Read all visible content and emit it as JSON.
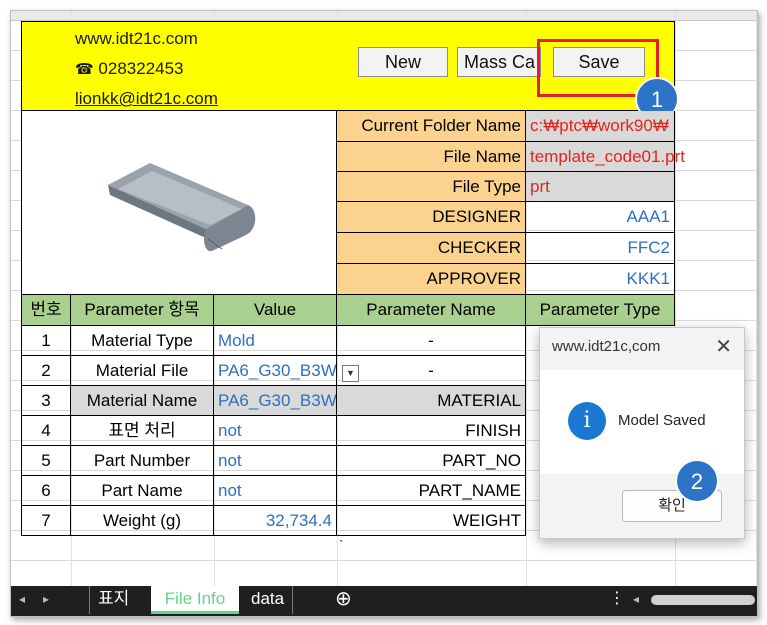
{
  "header": {
    "website": "www.idt21c.com",
    "phone_icon": "phone-icon",
    "phone": "028322453",
    "email": "lionkk@idt21c.com"
  },
  "buttons": {
    "new": "New",
    "mass_calc": "Mass Ca",
    "save": "Save"
  },
  "callouts": {
    "one": "1",
    "two": "2"
  },
  "file_info": [
    {
      "label": "Current Folder Name",
      "value": "c:₩ptc₩work90₩"
    },
    {
      "label": "File Name",
      "value": "template_code01.prt"
    },
    {
      "label": "File Type",
      "value": "prt"
    },
    {
      "label": "DESIGNER",
      "value": "AAA1"
    },
    {
      "label": "CHECKER",
      "value": "FFC2"
    },
    {
      "label": "APPROVER",
      "value": "KKK1"
    }
  ],
  "table": {
    "headers": [
      "번호",
      "Parameter 항목",
      "Value",
      "Parameter Name",
      "Parameter Type"
    ],
    "rows": [
      {
        "no": "1",
        "item": "Material Type",
        "value": "Mold",
        "pname": "-"
      },
      {
        "no": "2",
        "item": "Material File",
        "value": "PA6_G30_B3W",
        "pname": "-"
      },
      {
        "no": "3",
        "item": "Material Name",
        "value": "PA6_G30_B3W",
        "pname": "MATERIAL"
      },
      {
        "no": "4",
        "item": "표면 처리",
        "value": "not",
        "pname": "FINISH"
      },
      {
        "no": "5",
        "item": "Part Number",
        "value": "not",
        "pname": "PART_NO"
      },
      {
        "no": "6",
        "item": "Part Name",
        "value": "not",
        "pname": "PART_NAME"
      },
      {
        "no": "7",
        "item": "Weight (g)",
        "value": "32,734.4",
        "pname": "WEIGHT"
      }
    ],
    "stray_mark": "`"
  },
  "dialog": {
    "title": "www.idt21c,com",
    "message": "Model Saved",
    "ok": "확인",
    "info_icon": "i"
  },
  "tabs": {
    "t1": "표지",
    "t2": "File Info",
    "t3": "data",
    "add": "⊕"
  },
  "colors": {
    "yellow": "#ffff00",
    "orange": "#fbd38f",
    "green": "#a9d08e",
    "red_highlight": "#e0202a",
    "badge": "#2e74c6",
    "tab_active_text": "#5fd68a"
  }
}
